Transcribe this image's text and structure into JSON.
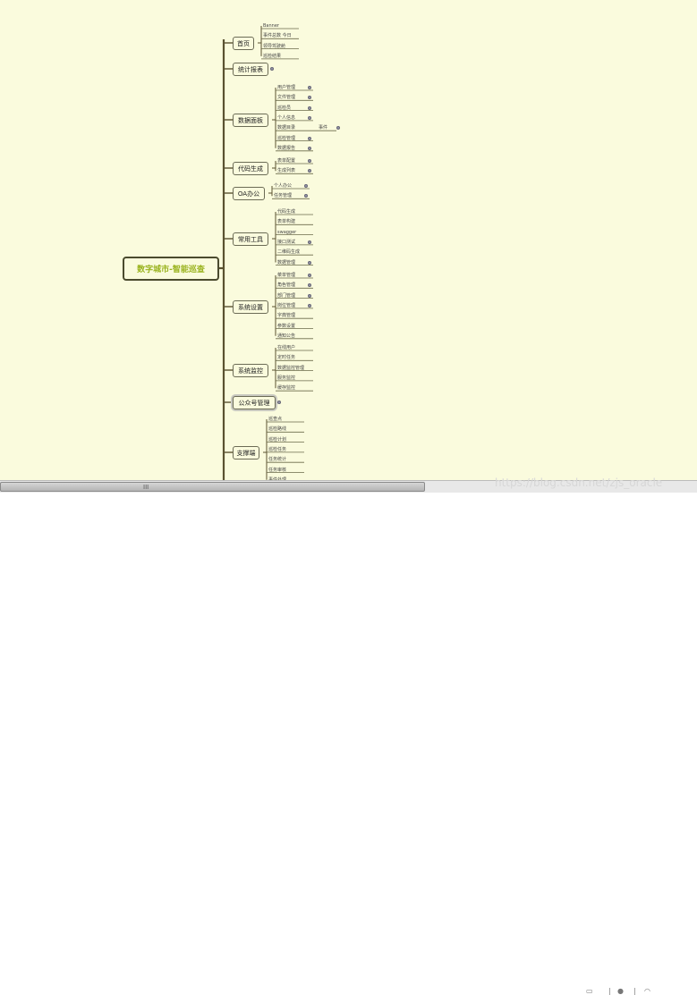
{
  "root": {
    "label": "数字城市-智能巡查"
  },
  "branches": [
    {
      "label": "首页",
      "leaves": [
        "Banner",
        "事件总数 今日",
        "领导驾驶舱",
        "巡检结果"
      ]
    },
    {
      "label": "统计报表",
      "leaves": []
    },
    {
      "label": "数据面板",
      "leaves": [
        "用户管理",
        "文件管理",
        "巡检员",
        "个人信息",
        "数据目录",
        "巡检管理",
        "数据报告"
      ],
      "extra": "事件"
    },
    {
      "label": "代码生成",
      "leaves": [
        "表单配置",
        "生成列表"
      ]
    },
    {
      "label": "OA办公",
      "leaves": [
        "个人办公",
        "任务管理"
      ]
    },
    {
      "label": "常用工具",
      "leaves": [
        "代码生成",
        "表单构建",
        "swagger",
        "接口测试",
        "二维码生成",
        "数据管理"
      ]
    },
    {
      "label": "系统设置",
      "leaves": [
        "菜单管理",
        "角色管理",
        "部门管理",
        "岗位管理",
        "字典管理",
        "参数设置",
        "通知公告"
      ]
    },
    {
      "label": "系统监控",
      "leaves": [
        "在线用户",
        "定时任务",
        "数据监控管理",
        "服务监控",
        "缓存监控"
      ]
    },
    {
      "label": "公众号管理",
      "leaves": []
    },
    {
      "label": "支撑端",
      "leaves": [
        "巡查点",
        "巡检路线",
        "巡检计划",
        "巡检任务",
        "任务统计",
        "任务审核",
        "事件处理"
      ]
    }
  ],
  "scrollbar": {
    "grip": "III"
  },
  "watermark": "https://blog.csdn.net/zjs_oracle"
}
